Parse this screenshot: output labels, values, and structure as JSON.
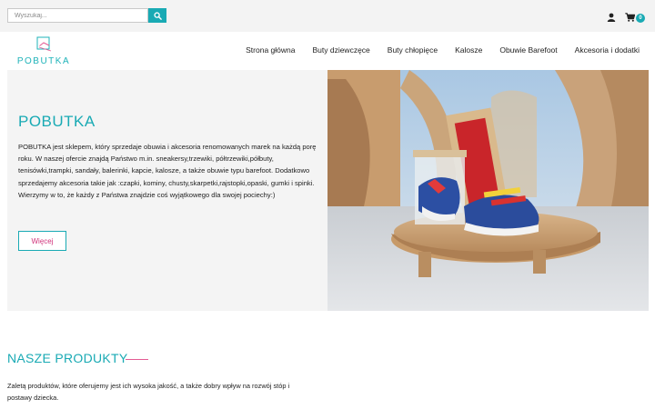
{
  "search": {
    "placeholder": "Wyszukaj..."
  },
  "cart": {
    "count": "0"
  },
  "logo": {
    "text": "POBUTKA"
  },
  "nav": {
    "items": [
      {
        "label": "Strona główna"
      },
      {
        "label": "Buty dziewczęce"
      },
      {
        "label": "Buty chłopięce"
      },
      {
        "label": "Kalosze"
      },
      {
        "label": "Obuwie Barefoot"
      },
      {
        "label": "Akcesoria i dodatki"
      }
    ]
  },
  "hero": {
    "title": "POBUTKA",
    "text": "POBUTKA  jest sklepem, który sprzedaje obuwia i akcesoria renomowanych marek na każdą porę roku. W naszej ofercie znajdą Państwo m.in. sneakersy,trzewiki, półtrzewiki,półbuty, tenisówki,trampki, sandały, balerinki, kapcie, kalosze, a także obuwie typu barefoot. Dodatkowo sprzedajemy akcesoria takie jak :czapki, kominy, chusty,skarpetki,rajstopki,opaski, gumki i spinki. Wierzymy w to, że każdy z Państwa znajdzie coś wyjątkowego dla swojej pociechy:)",
    "button_label": "Więcej"
  },
  "products": {
    "title": "NASZE PRODUKTY",
    "text": "Zaletą produktów, które oferujemy jest ich wysoka jakość, a także dobry wpływ na rozwój stóp i postawy dziecka."
  },
  "colors": {
    "accent": "#19aab4",
    "pink": "#d0327a",
    "panel": "#f4f4f4",
    "topbar": "#f3f3f3"
  },
  "icons": {
    "search": "search-icon",
    "user": "user-icon",
    "cart": "cart-icon"
  }
}
